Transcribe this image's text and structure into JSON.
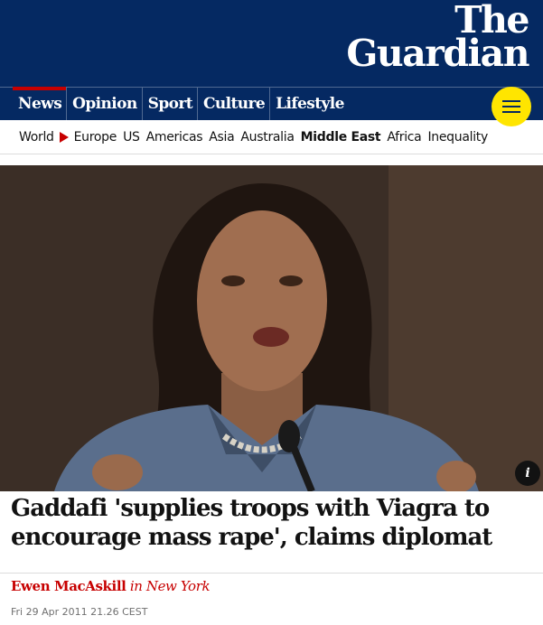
{
  "brand": {
    "line1": "The",
    "line2": "Guardian"
  },
  "pillars": [
    "News",
    "Opinion",
    "Sport",
    "Culture",
    "Lifestyle"
  ],
  "subnav": {
    "root": "World",
    "items": [
      "Europe",
      "US",
      "Americas",
      "Asia",
      "Australia",
      "Middle East",
      "Africa",
      "Inequality"
    ],
    "active": "Middle East"
  },
  "image": {
    "info_label": "i"
  },
  "article": {
    "headline": "Gaddafi 'supplies troops with Viagra to encourage mass rape', claims diplomat",
    "author": "Ewen MacAskill",
    "location": "in New York",
    "date": "Fri 29 Apr 2011 21.26 CEST"
  },
  "colors": {
    "masthead": "#052962",
    "accent": "#c70000",
    "menu": "#ffe500"
  }
}
